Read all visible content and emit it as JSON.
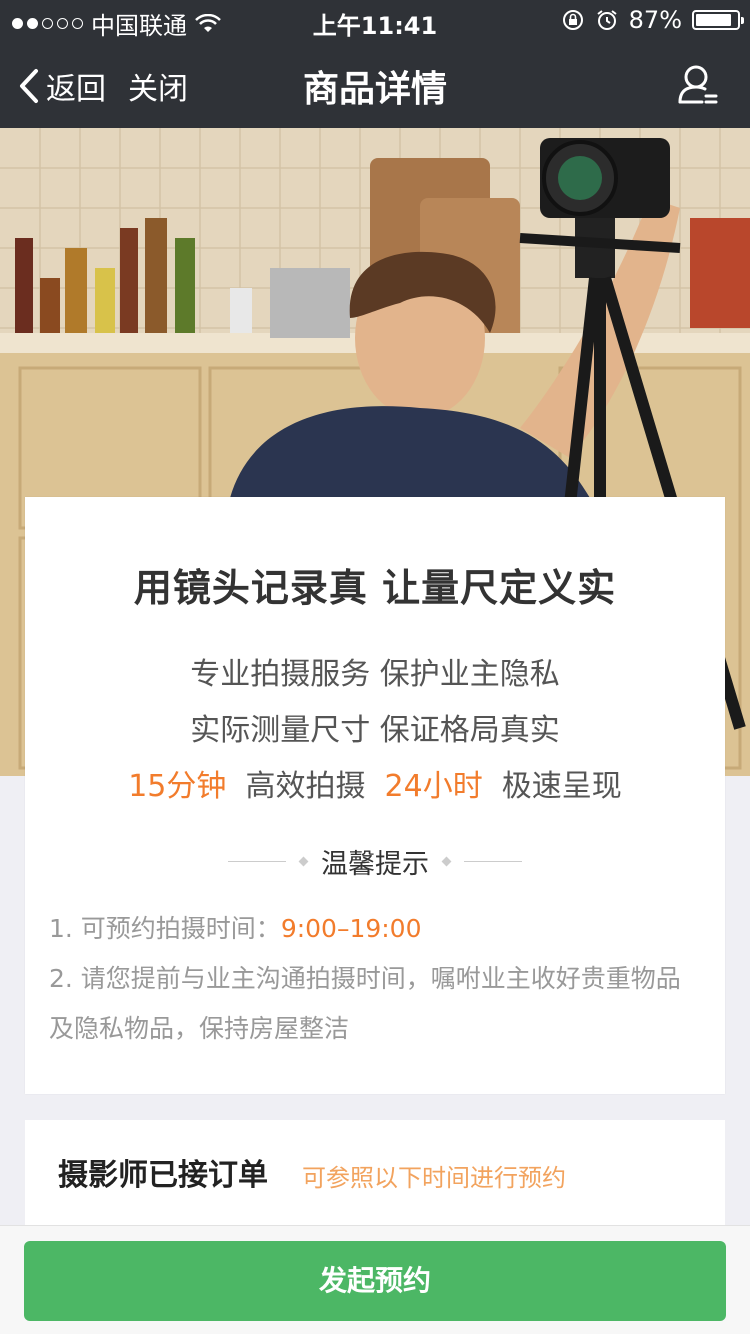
{
  "status_bar": {
    "carrier": "中国联通",
    "time": "上午11:41",
    "battery": "87%",
    "battery_level": 0.87,
    "signal_dots_filled": 2,
    "signal_dots_total": 5
  },
  "nav": {
    "back_label": "返回",
    "close_label": "关闭",
    "title": "商品详情"
  },
  "card": {
    "title": "用镜头记录真 让量尺定义实",
    "line1": "专业拍摄服务  保护业主隐私",
    "line2": "实际测量尺寸  保证格局真实",
    "line3": {
      "a_orange": "15分钟",
      "a_text": "高效拍摄",
      "b_orange": "24小时",
      "b_text": "极速呈现"
    },
    "tips_header": "温馨提示",
    "tip1_text": "1. 可预约拍摄时间：",
    "tip1_time": "9:00–19:00",
    "tip2": "2. 请您提前与业主沟通拍摄时间，嘱咐业主收好贵重物品及隐私物品，保持房屋整洁"
  },
  "card2": {
    "title": "摄影师已接订单",
    "subtitle": "可参照以下时间进行预约"
  },
  "bottom": {
    "book_button": "发起预约"
  },
  "colors": {
    "nav_bg": "#2f3237",
    "accent_orange": "#f27c2c",
    "button_green": "#4cb765"
  }
}
